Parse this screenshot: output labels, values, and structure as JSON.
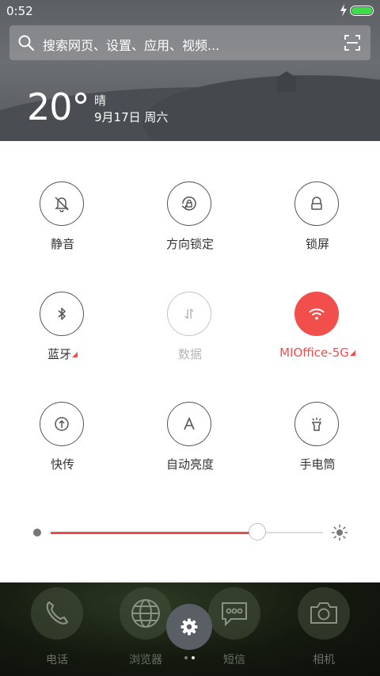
{
  "status_bar": {
    "time": "0:52"
  },
  "search": {
    "placeholder": "搜索网页、设置、应用、视频..."
  },
  "weather": {
    "temperature": "20°",
    "condition": "晴",
    "date": "9月17日 周六"
  },
  "toggles": [
    {
      "label": "静音",
      "icon": "mute-bell-icon",
      "state": "off"
    },
    {
      "label": "方向锁定",
      "icon": "rotation-lock-icon",
      "state": "off"
    },
    {
      "label": "锁屏",
      "icon": "lock-icon",
      "state": "off"
    },
    {
      "label": "蓝牙",
      "icon": "bluetooth-icon",
      "state": "off"
    },
    {
      "label": "数据",
      "icon": "mobile-data-icon",
      "state": "disabled"
    },
    {
      "label": "MIOffice-5G",
      "icon": "wifi-icon",
      "state": "on"
    },
    {
      "label": "快传",
      "icon": "quick-transfer-icon",
      "state": "off"
    },
    {
      "label": "自动亮度",
      "icon": "auto-brightness-icon",
      "state": "off"
    },
    {
      "label": "手电筒",
      "icon": "flashlight-icon",
      "state": "off"
    }
  ],
  "brightness": {
    "level": 0.76
  },
  "dock": {
    "apps": [
      {
        "label": "电话",
        "icon": "phone-icon"
      },
      {
        "label": "浏览器",
        "icon": "globe-icon"
      },
      {
        "label": "短信",
        "icon": "message-icon"
      },
      {
        "label": "相机",
        "icon": "camera-icon"
      }
    ],
    "page_count": 2
  },
  "colors": {
    "accent": "#f24e4c",
    "battery": "#3ddc4a"
  }
}
